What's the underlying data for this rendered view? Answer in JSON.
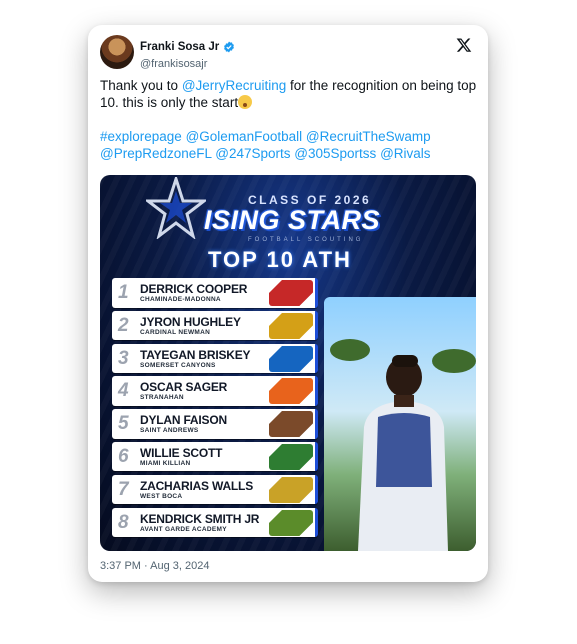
{
  "author": {
    "name": "Franki Sosa Jr",
    "handle": "@frankisosajr"
  },
  "tweet": {
    "line1_prefix": "Thank you to ",
    "mention_main": "@JerryRecruiting",
    "line1_suffix": "  for the recognition on being top 10. this is only the start",
    "tags": [
      "#explorepage",
      "@GolemanFootball",
      "@RecruitTheSwamp",
      "@PrepRedzoneFL",
      "@247Sports",
      "@305Sportss",
      "@Rivals"
    ]
  },
  "graphic": {
    "class_of": "CLASS OF 2026",
    "brand": "ISING STARS",
    "brand_sub": "FOOTBALL SCOUTING",
    "headline": "TOP 10 ATH",
    "rankings": [
      {
        "rank": "1",
        "name": "DERRICK COOPER",
        "school": "CHAMINADE-MADONNA",
        "logo_color": "#c62828"
      },
      {
        "rank": "2",
        "name": "JYRON HUGHLEY",
        "school": "CARDINAL NEWMAN",
        "logo_color": "#d4a017"
      },
      {
        "rank": "3",
        "name": "TAYEGAN BRISKEY",
        "school": "SOMERSET CANYONS",
        "logo_color": "#1565c0"
      },
      {
        "rank": "4",
        "name": "OSCAR SAGER",
        "school": "STRANAHAN",
        "logo_color": "#e8631c"
      },
      {
        "rank": "5",
        "name": "DYLAN FAISON",
        "school": "SAINT ANDREWS",
        "logo_color": "#7b4a2a"
      },
      {
        "rank": "6",
        "name": "WILLIE SCOTT",
        "school": "MIAMI KILLIAN",
        "logo_color": "#2e7d32"
      },
      {
        "rank": "7",
        "name": "ZACHARIAS WALLS",
        "school": "WEST BOCA",
        "logo_color": "#c9a227"
      },
      {
        "rank": "8",
        "name": "KENDRICK SMITH JR",
        "school": "AVANT GARDE ACADEMY",
        "logo_color": "#5b8c2a"
      }
    ]
  },
  "timestamp": "3:37 PM · Aug 3, 2024",
  "colors": {
    "link": "#1d9bf0",
    "verified": "#1d9bf0",
    "graphic_navy": "#0a1a44",
    "graphic_accent": "#1d4ed8"
  },
  "icons": {
    "close": "x-logo-icon",
    "verified": "verified-badge-icon",
    "brand": "star-logo-icon"
  }
}
